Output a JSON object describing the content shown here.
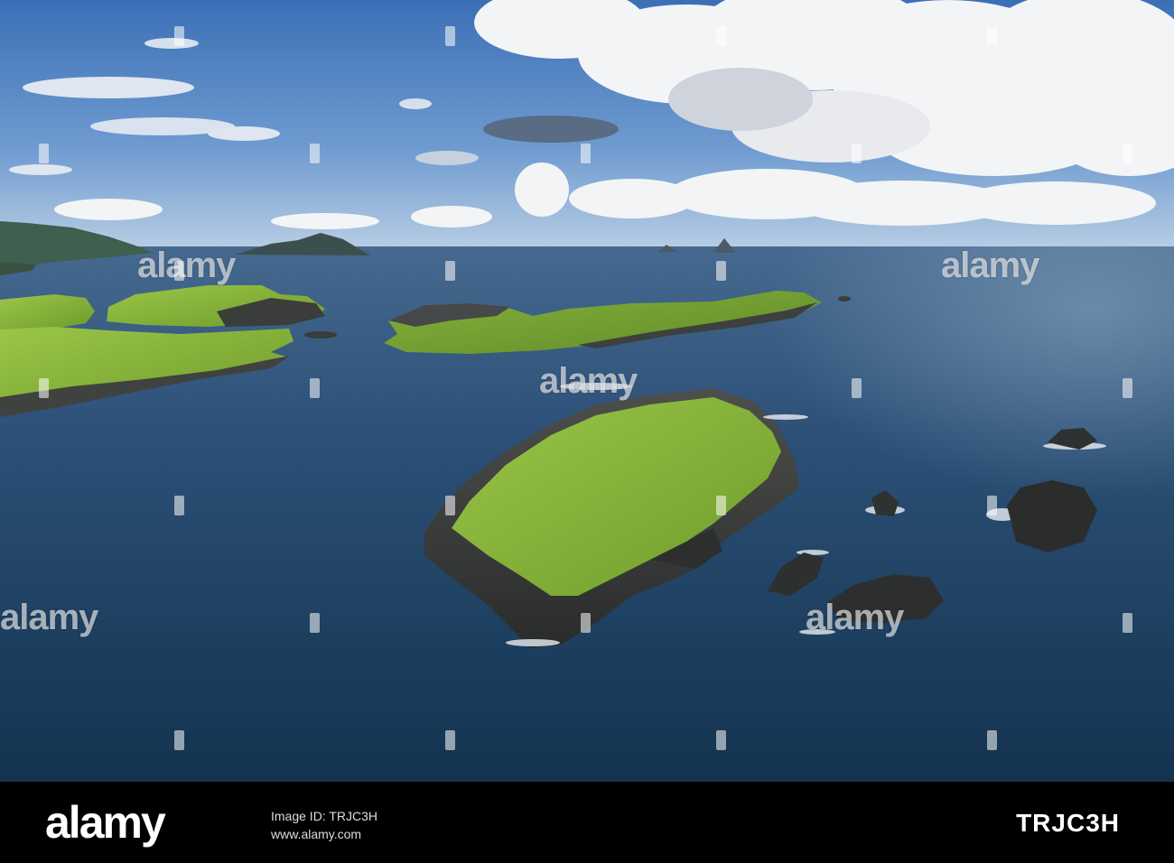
{
  "watermark": {
    "brand": "alamy",
    "image_id": "TRJC3H",
    "bottom_line_1": "Image ID: TRJC3H",
    "bottom_line_2": "www.alamy.com"
  },
  "scene": {
    "subject": "coastal-islands",
    "colors": {
      "sky_top": "#3f73b8",
      "sky_horizon": "#a9c3df",
      "sea_far": "#3b5d85",
      "sea_near": "#16385a",
      "grass": "#8cbd3b",
      "rock": "#3a3d3d",
      "cloud": "#f2f2f2"
    }
  }
}
